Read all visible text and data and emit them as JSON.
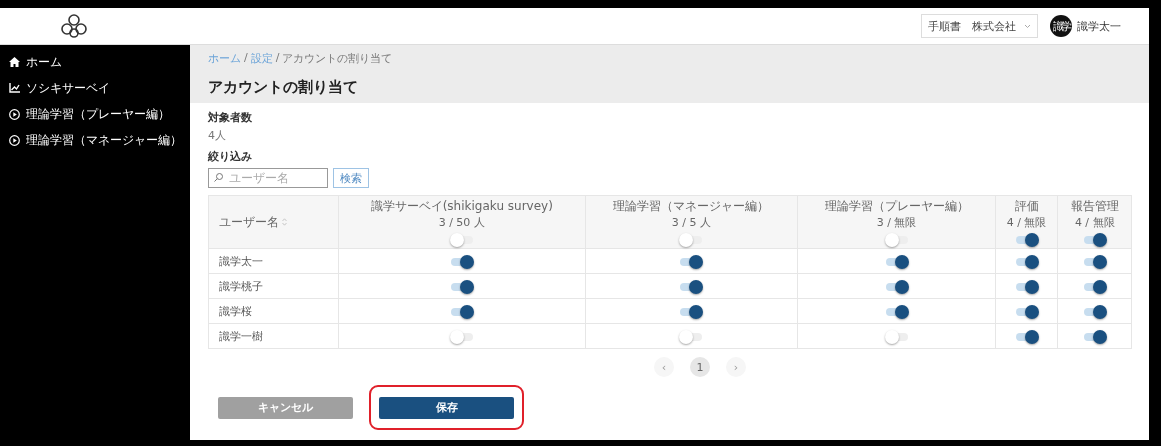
{
  "header": {
    "company_select": {
      "value": "手順書　株式会社"
    },
    "user": {
      "avatar_text": "識学",
      "name": "識学太一"
    }
  },
  "sidebar": {
    "items": [
      {
        "label": "ホーム",
        "kind": "home",
        "selected": false
      },
      {
        "label": "ソシキサーベイ",
        "kind": "survey",
        "selected": false
      },
      {
        "label": "理論学習（プレーヤー編）",
        "kind": "course",
        "selected": false
      },
      {
        "label": "理論学習（マネージャー編）",
        "kind": "course",
        "selected": false
      }
    ]
  },
  "breadcrumb": {
    "separator": "/",
    "items": [
      "ホーム",
      "設定",
      "アカウントの割り当て"
    ]
  },
  "page_title": "アカウントの割り当て",
  "target_count": {
    "label": "対象者数",
    "value": "4人"
  },
  "filter": {
    "label": "絞り込み",
    "placeholder": "ユーザー名",
    "button": "検索"
  },
  "table": {
    "name_column": "ユーザー名",
    "columns": [
      {
        "title": "識学サーベイ(shikigaku survey)",
        "count": "3 / 50 人",
        "on": false
      },
      {
        "title": "理論学習（マネージャー編）",
        "count": "3 / 5 人",
        "on": false
      },
      {
        "title": "理論学習（プレーヤー編）",
        "count": "3 / 無限",
        "on": false
      },
      {
        "title": "評価",
        "count": "4 / 無限",
        "on": true
      },
      {
        "title": "報告管理",
        "count": "4 / 無限",
        "on": true
      }
    ],
    "rows": [
      {
        "name": "識学太一",
        "toggles": [
          true,
          true,
          true,
          true,
          true
        ]
      },
      {
        "name": "識学桃子",
        "toggles": [
          true,
          true,
          true,
          true,
          true
        ]
      },
      {
        "name": "識学桜",
        "toggles": [
          true,
          true,
          true,
          true,
          true
        ]
      },
      {
        "name": "識学一樹",
        "toggles": [
          false,
          false,
          false,
          true,
          true
        ]
      }
    ]
  },
  "pagination": {
    "prev": "‹",
    "pages": [
      {
        "label": "1",
        "selected": true
      }
    ],
    "next": "›"
  },
  "buttons": [
    {
      "label": "キャンセル",
      "kind": "cancel",
      "highlighted": false
    },
    {
      "label": "保存",
      "kind": "primary",
      "highlighted": true
    }
  ]
}
